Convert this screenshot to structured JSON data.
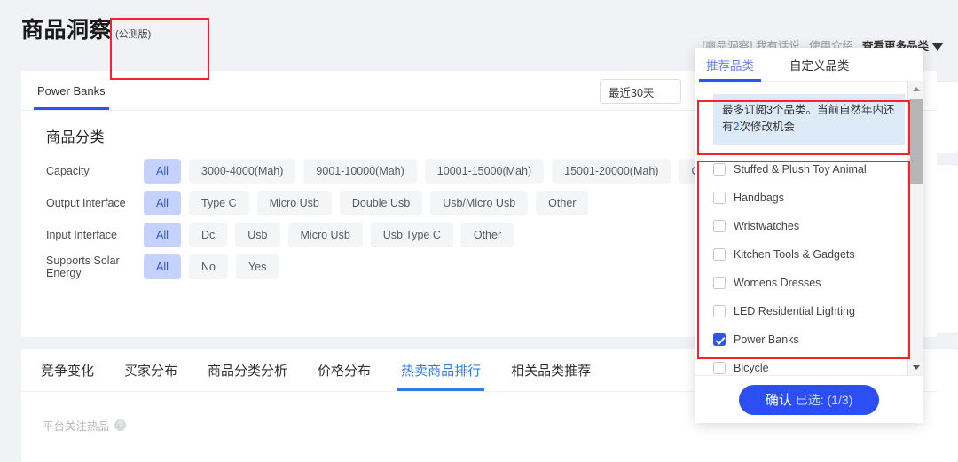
{
  "header": {
    "title": "商品洞察",
    "subtitle": "(公测版)",
    "links": [
      {
        "label": "[商品洞察] 我有话说",
        "strong": false
      },
      {
        "label": "使用介绍",
        "strong": false
      },
      {
        "label": "查看更多品类",
        "strong": true
      }
    ]
  },
  "main_card": {
    "category_tab": "Power Banks",
    "date_range": "最近30天",
    "filter_title": "商品分类",
    "filters": [
      {
        "label": "Capacity",
        "options": [
          "All",
          "3000-4000(Mah)",
          "9001-10000(Mah)",
          "10001-15000(Mah)",
          "15001-20000(Mah)",
          "Other"
        ],
        "selected": "All"
      },
      {
        "label": "Output Interface",
        "options": [
          "All",
          "Type C",
          "Micro Usb",
          "Double Usb",
          "Usb/Micro Usb",
          "Other"
        ],
        "selected": "All"
      },
      {
        "label": "Input Interface",
        "options": [
          "All",
          "Dc",
          "Usb",
          "Micro Usb",
          "Usb Type C",
          "Other"
        ],
        "selected": "All"
      },
      {
        "label": "Supports Solar Energy",
        "options": [
          "All",
          "No",
          "Yes"
        ],
        "selected": "All"
      }
    ]
  },
  "bottom_card": {
    "tabs": [
      {
        "label": "竞争变化",
        "active": false
      },
      {
        "label": "买家分布",
        "active": false
      },
      {
        "label": "商品分类分析",
        "active": false
      },
      {
        "label": "价格分布",
        "active": false
      },
      {
        "label": "热卖商品排行",
        "active": true
      },
      {
        "label": "相关品类推荐",
        "active": false
      }
    ],
    "section_title": "平台关注热品",
    "help_glyph": "?"
  },
  "dropdown": {
    "tabs": [
      {
        "label": "推荐品类",
        "active": true
      },
      {
        "label": "自定义品类",
        "active": false
      }
    ],
    "notice": {
      "part1": "最多订阅3个品类。当前自然年内还有",
      "highlight": "2",
      "part2": "次修改机会"
    },
    "items": [
      {
        "label": "Stuffed & Plush Toy Animal",
        "checked": false
      },
      {
        "label": "Handbags",
        "checked": false
      },
      {
        "label": "Wristwatches",
        "checked": false
      },
      {
        "label": "Kitchen Tools & Gadgets",
        "checked": false
      },
      {
        "label": "Womens Dresses",
        "checked": false
      },
      {
        "label": "LED Residential Lighting",
        "checked": false
      },
      {
        "label": "Power Banks",
        "checked": true
      },
      {
        "label": "Bicycle",
        "checked": false
      }
    ],
    "confirm": {
      "label": "确认",
      "selected_text": "已选: (1/3)"
    }
  },
  "colors": {
    "accent_blue": "#2f54eb",
    "tab_blue": "#2f7ce8",
    "annotation_red": "#f5232c",
    "chip_selected_bg": "#c5d2ff",
    "notice_bg": "#ddeaf8"
  }
}
